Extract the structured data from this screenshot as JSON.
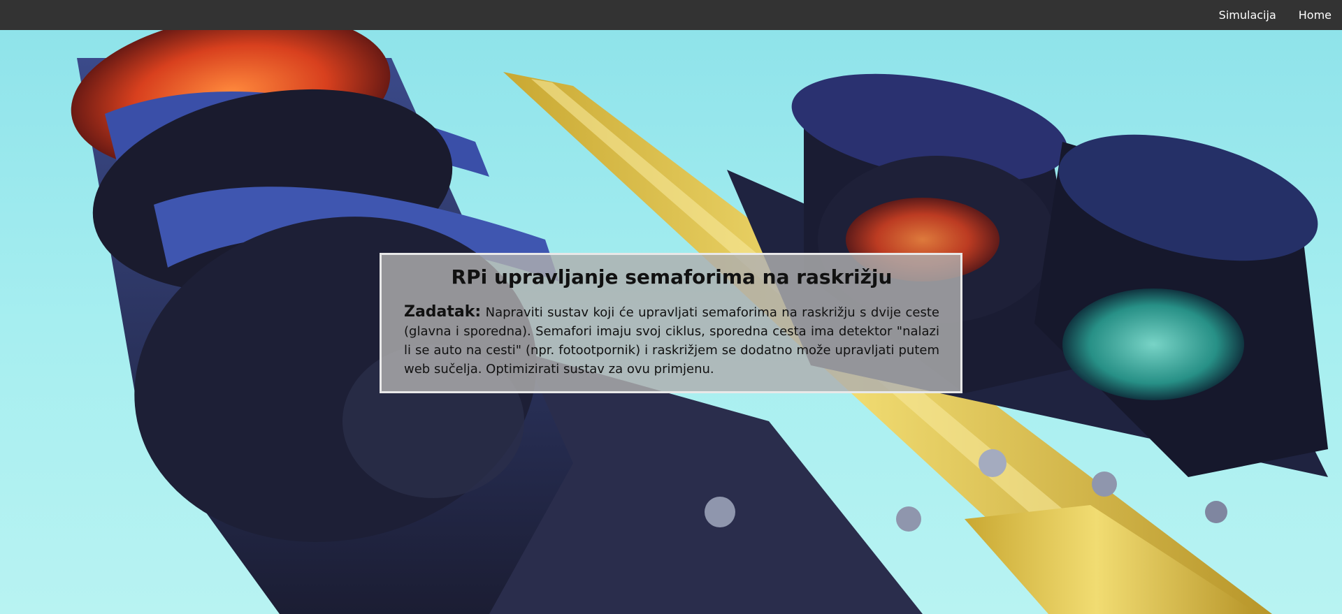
{
  "nav": {
    "items": [
      {
        "label": "Simulacija"
      },
      {
        "label": "Home"
      }
    ]
  },
  "main": {
    "title": "RPi upravljanje semaforima na raskrižju",
    "task_label": "Zadatak:",
    "task_text": "Napraviti sustav koji će upravljati semaforima na raskrižju s dvije ceste (glavna i sporedna). Semafori imaju svoj ciklus, sporedna cesta ima detektor \"nalazi li se auto na cesti\" (npr. fotootpornik) i raskrižjem se dodatno može upravljati putem web sučelja. Optimizirati sustav za ovu primjenu."
  },
  "colors": {
    "navbar": "#333333",
    "sky": "#a6eef0",
    "pole": "#e3c94a",
    "housing": "#23253f",
    "red_light": "#d8401e",
    "green_light": "#4ad6c0"
  }
}
